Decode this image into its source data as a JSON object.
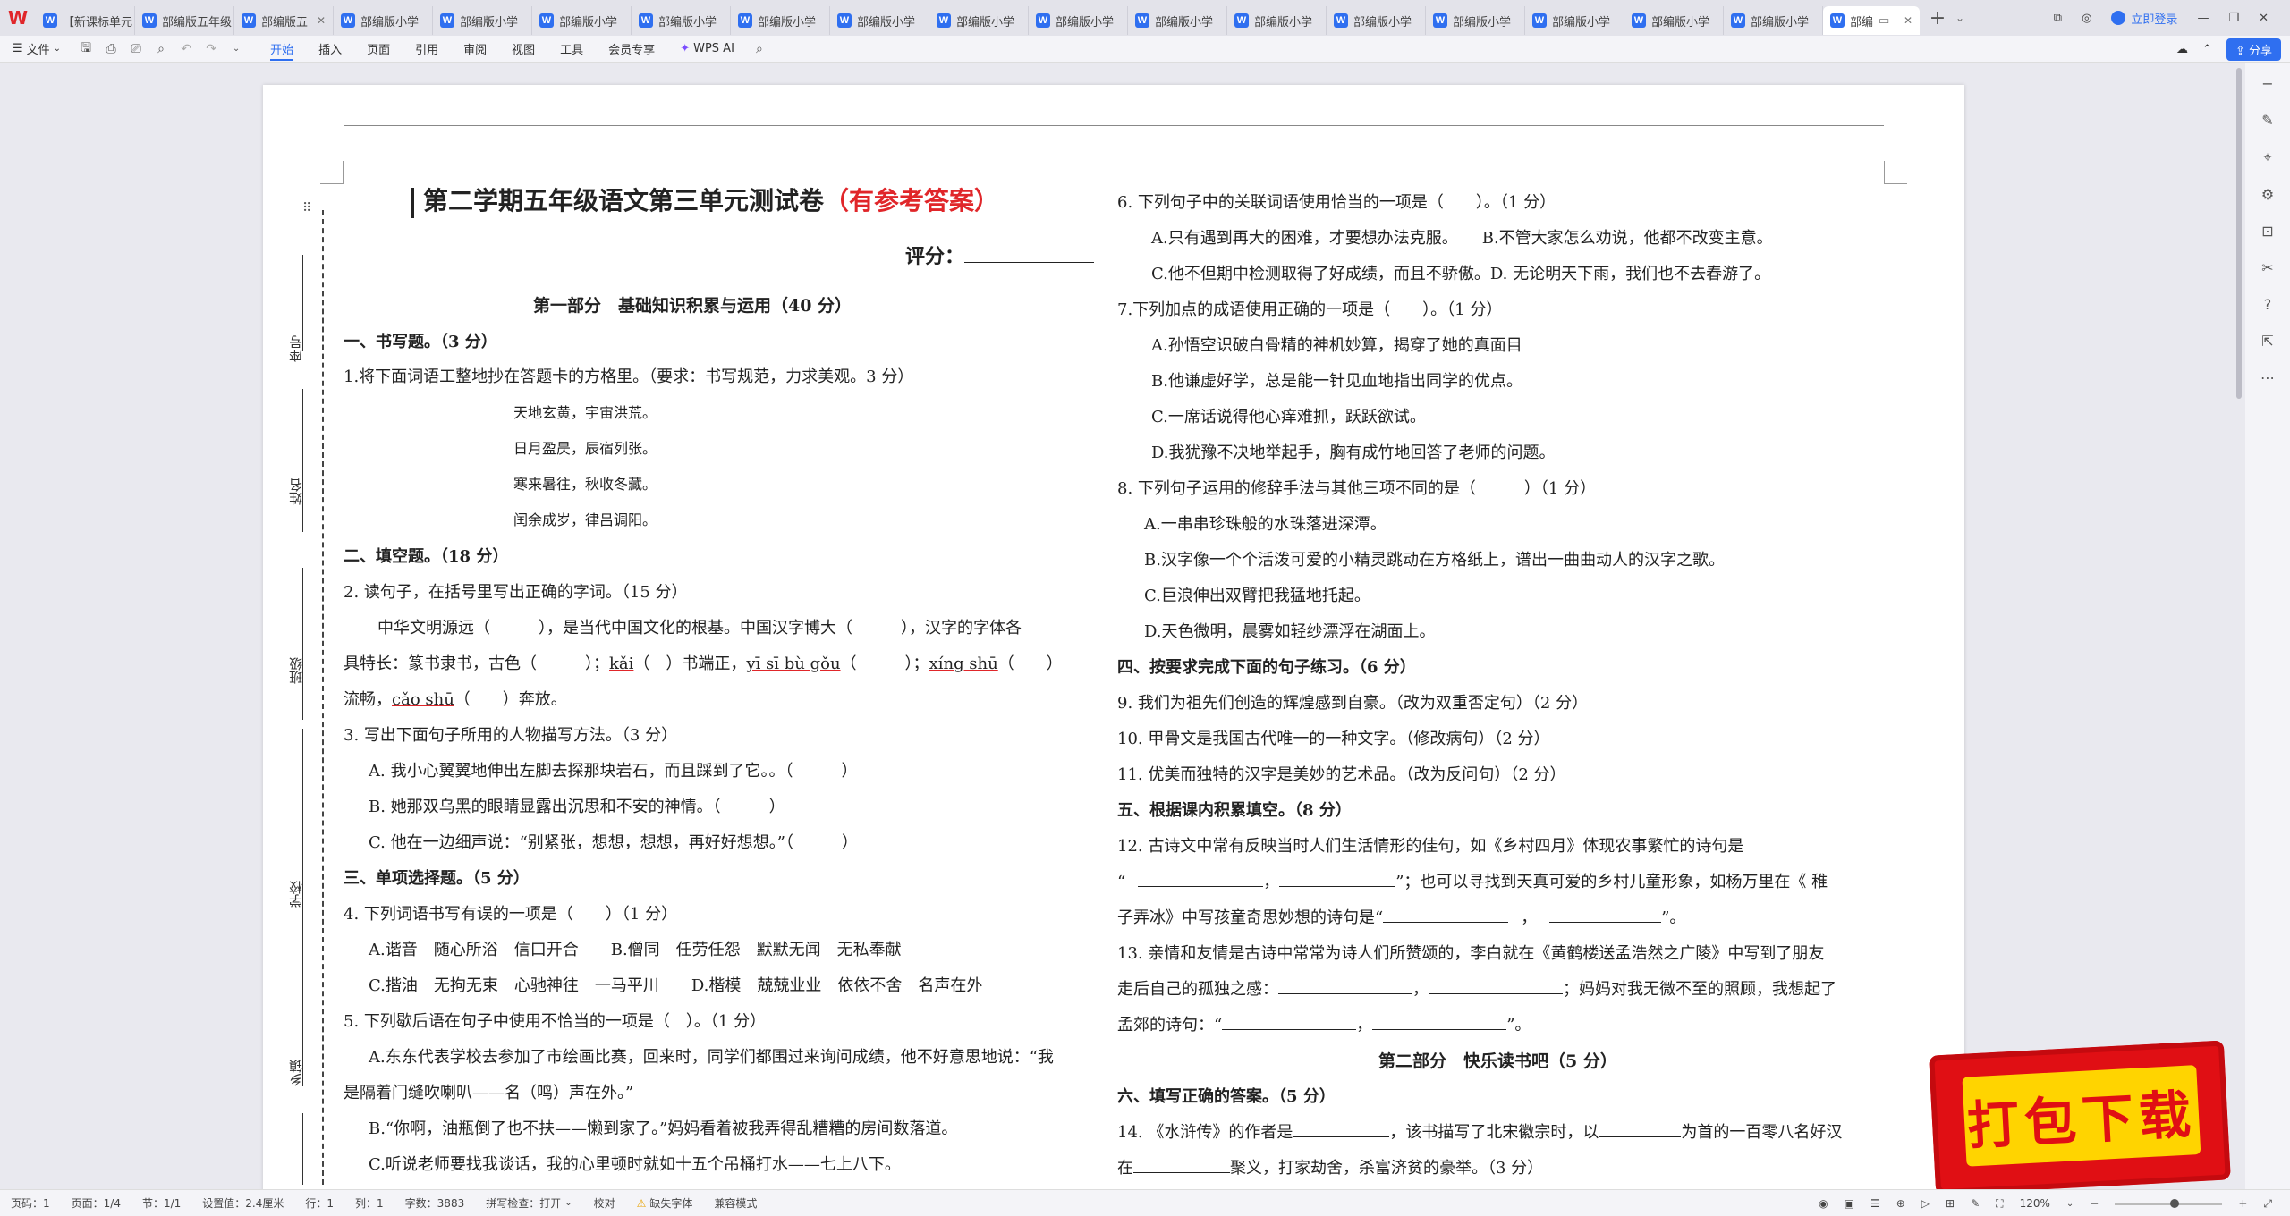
{
  "tabs": [
    {
      "label": "【新课标单元"
    },
    {
      "label": "部编版五年级"
    },
    {
      "label": "部编版五"
    },
    {
      "label": "部编版小学"
    },
    {
      "label": "部编版小学"
    },
    {
      "label": "部编版小学"
    },
    {
      "label": "部编版小学"
    },
    {
      "label": "部编版小学"
    },
    {
      "label": "部编版小学"
    },
    {
      "label": "部编版小学"
    },
    {
      "label": "部编版小学"
    },
    {
      "label": "部编版小学"
    },
    {
      "label": "部编版小学"
    },
    {
      "label": "部编版小学"
    },
    {
      "label": "部编版小学"
    },
    {
      "label": "部编版小学"
    },
    {
      "label": "部编版小学"
    },
    {
      "label": "部编版小学"
    }
  ],
  "active_tab": {
    "label": "部编"
  },
  "login_label": "立即登录",
  "toolbar": {
    "file_label": "文件",
    "menus": [
      "开始",
      "插入",
      "页面",
      "引用",
      "审阅",
      "视图",
      "工具",
      "会员专享"
    ],
    "wps_ai_label": "WPS AI",
    "share_label": "分享"
  },
  "binding": {
    "class_no": "座号",
    "name": "姓名",
    "class": "班级",
    "school": "学校",
    "town": "乡镇"
  },
  "doc": {
    "title": "第二学期五年级语文第三单元测试卷",
    "title_red": "（有参考答案）",
    "score_label": "评分：",
    "part1": "第一部分　基础知识积累与运用（40 分）",
    "s1": "一、书写题。（3 分）",
    "q1": "1.将下面词语工整地抄在答题卡的方格里。（要求：书写规范，力求美观。3 分）",
    "poem": [
      "天地玄黄，宇宙洪荒。",
      "日月盈昃，辰宿列张。",
      "寒来暑往，秋收冬藏。",
      "闰余成岁，律吕调阳。"
    ],
    "s2": "二、填空题。（18 分）",
    "q2": "2.  读句子，在括号里写出正确的字词。（15 分）",
    "q2_l1": "中华文明源远（　　　），是当代中国文化的根基。中国汉字博大（　　　），汉字的字体各",
    "q2_l2a": "具特长：篆书隶书，古色（　　　）；",
    "q2_l2b": "kǎi",
    "q2_l2c": "（　）书端正，",
    "q2_l2d": "yī  sī  bù gǒu",
    "q2_l2e": "（　　　）；",
    "q2_l2f": "xíng shū",
    "q2_l2g": "（　　）",
    "q2_l3a": "流畅，",
    "q2_l3b": "cǎo  shū",
    "q2_l3c": "（　　）奔放。",
    "q3": "3.  写出下面句子所用的人物描写方法。（3 分）",
    "q3_a": "A.  我小心翼翼地伸出左脚去探那块岩石，而且踩到了它。。（　　　）",
    "q3_b": "B.  她那双乌黑的眼睛显露出沉思和不安的神情。（　　　）",
    "q3_c": "C.  他在一边细声说：“别紧张，想想，想想，再好好想想。”（　　　）",
    "s3": "三、单项选择题。（5 分）",
    "q4": "4.  下列词语书写有误的一项是（　　）（1 分）",
    "q4_l1": "A.谐音　随心所浴　信口开合　　B.僧同　任劳任怨　默默无闻　无私奉献",
    "q4_l2": "C.揩油　无拘无束　心驰神往　一马平川　　D.楷模　兢兢业业　依依不舍　名声在外",
    "q5": "5.  下列歇后语在句子中使用不恰当的一项是（　）。（1 分）",
    "q5_a1": "A.东东代表学校去参加了市绘画比赛，回来时，同学们都围过来询问成绩，他不好意思地说：“我",
    "q5_a2": "是隔着门缝吹喇叭——名（鸣）声在外。”",
    "q5_b": "B.“你啊，油瓶倒了也不扶——懒到家了。”妈妈看着被我弄得乱糟糟的房间数落道。",
    "q5_c": "C.听说老师要找我谈话，我的心里顿时就如十五个吊桶打水——七上八下。",
    "q6": "6.  下列句子中的关联词语使用恰当的一项是（　　）。（1 分）",
    "q6_ab": "A.只有遇到再大的困难，才要想办法克服。　　B.不管大家怎么劝说，他都不改变主意。",
    "q6_cd": "C.他不但期中检测取得了好成绩，而且不骄傲。D.  无论明天下雨，我们也不去春游了。",
    "q7": "7.下列加点的成语使用正确的一项是（　　）。（1 分）",
    "q7_a": "A.孙悟空识破白骨精的神机妙算，揭穿了她的真面目",
    "q7_b": "B.他谦虚好学，总是能一针见血地指出同学的优点。",
    "q7_c": "C.一席话说得他心痒难抓，跃跃欲试。",
    "q7_d": "D.我犹豫不决地举起手，胸有成竹地回答了老师的问题。",
    "q8": "8.  下列句子运用的修辞手法与其他三项不同的是（　　　）（1 分）",
    "q8_a": "A.一串串珍珠般的水珠落进深潭。",
    "q8_b": "B.汉字像一个个活泼可爱的小精灵跳动在方格纸上，谱出一曲曲动人的汉字之歌。",
    "q8_c": "C.巨浪伸出双臂把我猛地托起。",
    "q8_d": "D.天色微明，晨雾如轻纱漂浮在湖面上。",
    "s4": "四、按要求完成下面的句子练习。（6 分）",
    "q9": "9.  我们为祖先们创造的辉煌感到自豪。（改为双重否定句）（2 分）",
    "q10": "10.  甲骨文是我国古代唯一的一种文字。（修改病句）（2 分）",
    "q11": "11.  优美而独特的汉字是美妙的艺术品。（改为反问句）（2 分）",
    "s5": "五、根据课内积累填空。（8 分）",
    "q12_l1": "12.  古诗文中常有反映当时人们生活情形的佳句，如《乡村四月》体现农事繁忙的诗句是",
    "q12_l2a": "“",
    "q12_l2b": "，",
    "q12_l2c": "”；也可以寻找到天真可爱的乡村儿童形象，如杨万里在《 稚",
    "q12_l3a": "子弄冰》中写孩童奇思妙想的诗句是“",
    "q12_l3b": "，",
    "q12_l3c": "”。",
    "q13_l1": "13.  亲情和友情是古诗中常常为诗人们所赞颂的，李白就在《黄鹤楼送孟浩然之广陵》中写到了朋友",
    "q13_l2a": "走后自己的孤独之感：",
    "q13_l2b": "，",
    "q13_l2c": "；妈妈对我无微不至的照顾，我想起了",
    "q13_l3a": "孟郊的诗句：“",
    "q13_l3b": "，",
    "q13_l3c": "”。",
    "part2": "第二部分　快乐读书吧（5 分）",
    "s6": "六、填写正确的答案。（5 分）",
    "q14_l1a": "14.  《水浒传》的作者是",
    "q14_l1b": "，该书描写了北宋徽宗时，以",
    "q14_l1c": "为首的一百零八名好汉",
    "q14_l2a": "在",
    "q14_l2b": "聚义，打家劫舍，杀富济贫的豪举。（3 分）"
  },
  "badge_text": "打包下载",
  "status": {
    "page_no": "页码：1",
    "pages": "页面：1/4",
    "section": "节：1/1",
    "setting": "设置值：2.4厘米",
    "row": "行：1",
    "col": "列：1",
    "words": "字数：3883",
    "spell": "拼写检查：打开",
    "proof": "校对",
    "missing_font": "缺失字体",
    "compat": "兼容模式",
    "zoom": "120%"
  }
}
